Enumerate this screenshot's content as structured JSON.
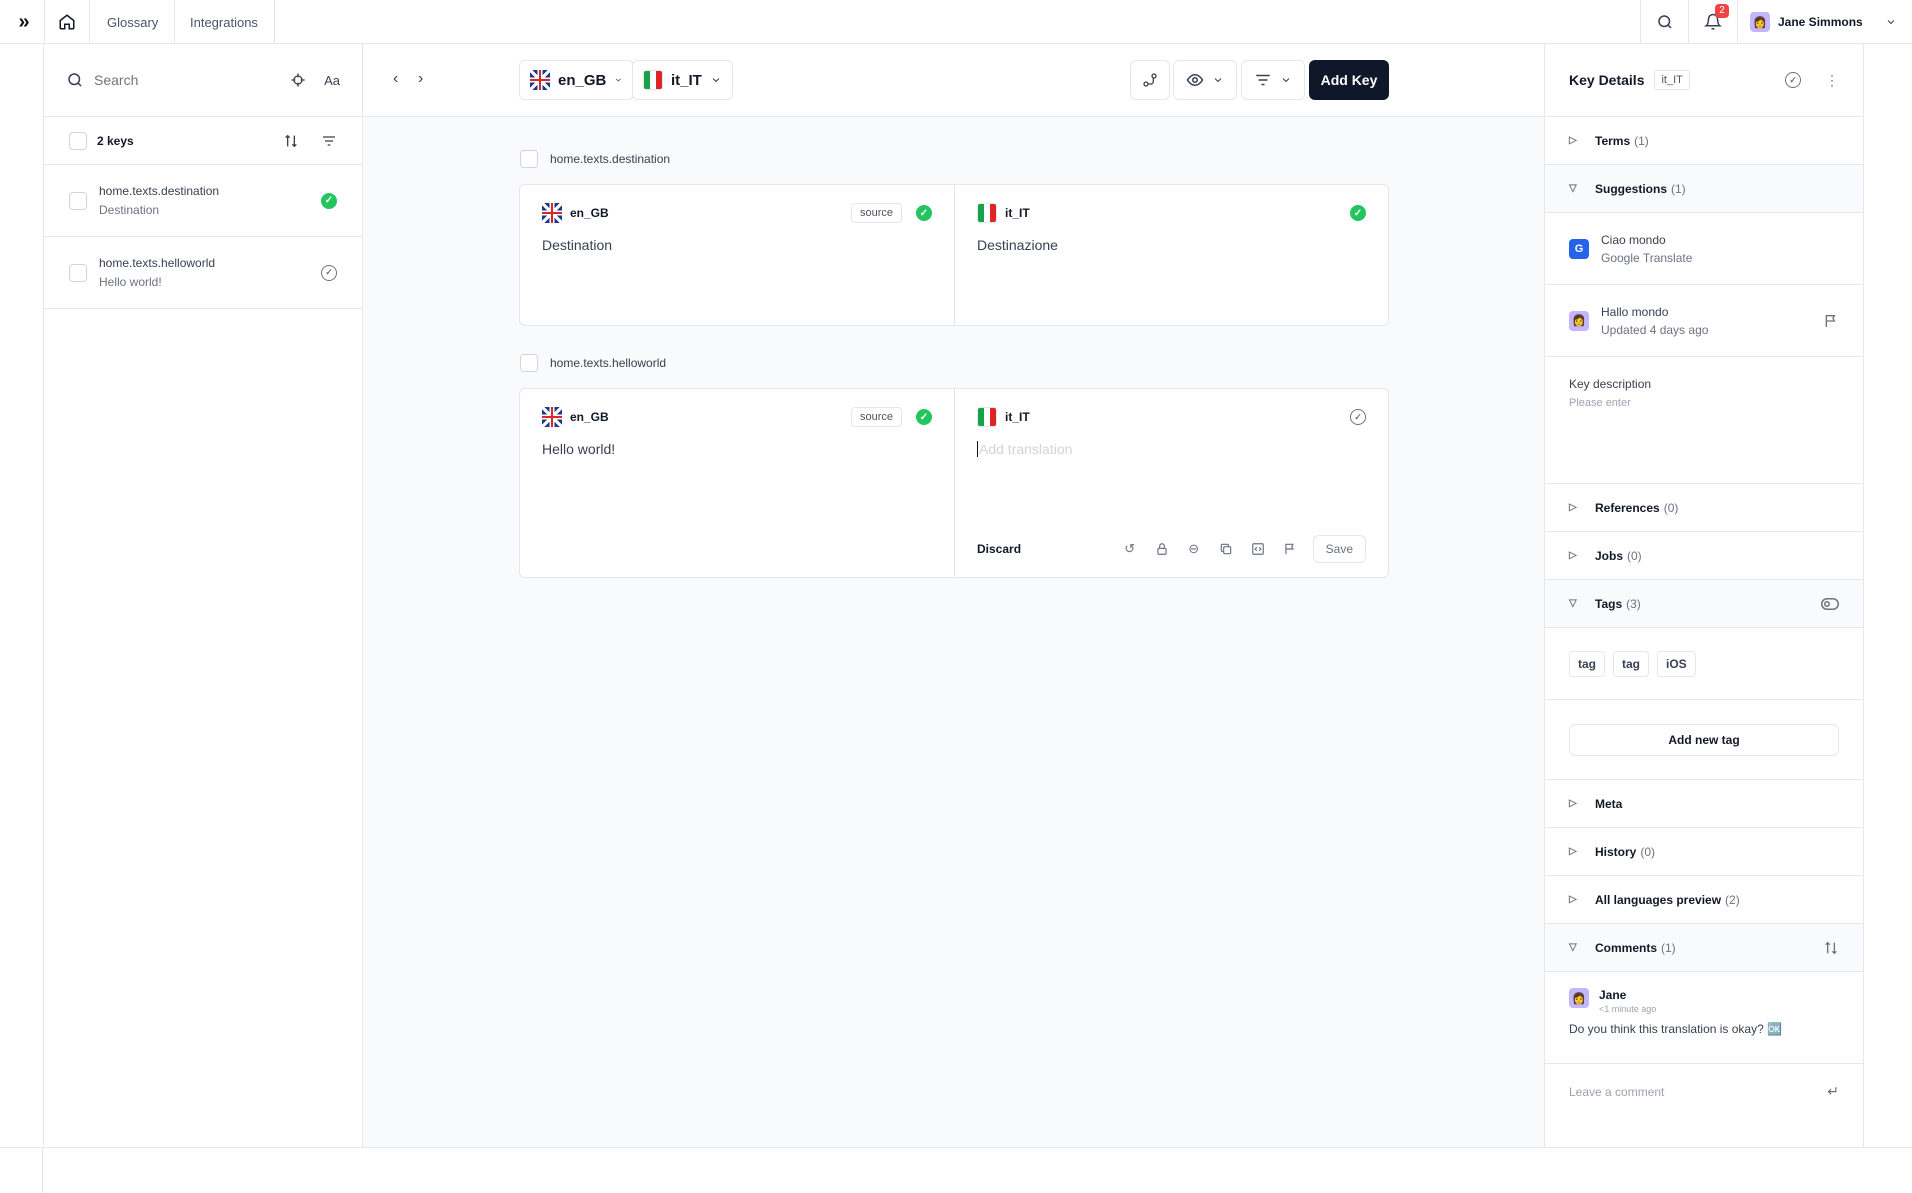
{
  "topbar": {
    "nav": [
      "Glossary",
      "Integrations"
    ],
    "notifications_count": "2",
    "user_name": "Jane Simmons"
  },
  "left": {
    "search_placeholder": "Search",
    "keys_count": "2 keys",
    "keys": [
      {
        "key": "home.texts.destination",
        "value": "Destination",
        "status": "done"
      },
      {
        "key": "home.texts.helloworld",
        "value": "Hello world!",
        "status": "pending"
      }
    ]
  },
  "toolbar": {
    "source_lang": "en_GB",
    "target_lang": "it_IT",
    "add_key": "Add Key"
  },
  "main": {
    "groups": [
      {
        "key": "home.texts.destination",
        "source_lang": "en_GB",
        "source_tag": "source",
        "source_text": "Destination",
        "target_lang": "it_IT",
        "target_text": "Destinazione"
      },
      {
        "key": "home.texts.helloworld",
        "source_lang": "en_GB",
        "source_tag": "source",
        "source_text": "Hello world!",
        "target_lang": "it_IT",
        "target_placeholder": "Add translation",
        "discard": "Discard",
        "save": "Save"
      }
    ]
  },
  "right": {
    "title": "Key Details",
    "lang": "it_IT",
    "sections": {
      "terms": {
        "label": "Terms",
        "count": "(1)"
      },
      "suggestions": {
        "label": "Suggestions",
        "count": "(1)"
      },
      "references": {
        "label": "References",
        "count": "(0)"
      },
      "jobs": {
        "label": "Jobs",
        "count": "(0)"
      },
      "tags": {
        "label": "Tags",
        "count": "(3)"
      },
      "meta": {
        "label": "Meta"
      },
      "history": {
        "label": "History",
        "count": "(0)"
      },
      "languages": {
        "label": "All languages preview",
        "count": "(2)"
      },
      "comments": {
        "label": "Comments",
        "count": "(1)"
      }
    },
    "suggestions": [
      {
        "text": "Ciao mondo",
        "source": "Google Translate"
      },
      {
        "text": "Hallo mondo",
        "source": "Updated 4 days ago"
      }
    ],
    "description": {
      "label": "Key description",
      "placeholder": "Please enter"
    },
    "tags": [
      "tag",
      "tag",
      "iOS"
    ],
    "add_tag": "Add  new tag",
    "comment": {
      "author": "Jane",
      "time": "<1 minute ago",
      "body": "Do you think this translation is okay? 🆗"
    },
    "leave_comment": "Leave a comment"
  }
}
